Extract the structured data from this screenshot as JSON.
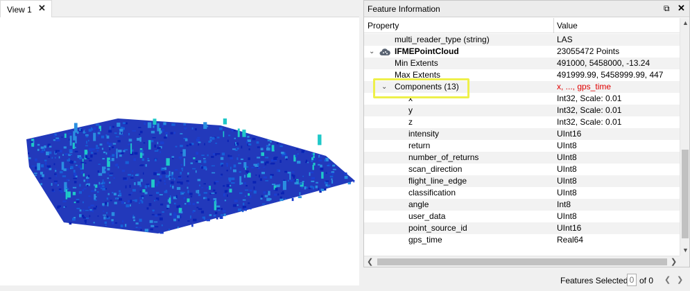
{
  "view": {
    "tab_label": "View 1",
    "close_glyph": "✕"
  },
  "panel": {
    "title": "Feature Information",
    "float_glyph": "⧉",
    "close_glyph": "✕",
    "col_property": "Property",
    "col_value": "Value"
  },
  "rows": [
    {
      "prop": "multi_reader_type (string)",
      "val": "LAS"
    },
    {
      "prop": "IFMEPointCloud",
      "val": "23055472 Points",
      "icon": "point-cloud-icon"
    },
    {
      "prop": "Min Extents",
      "val": "491000, 5458000, -13.24"
    },
    {
      "prop": "Max Extents",
      "val": "491999.99, 5458999.99, 447"
    },
    {
      "prop": "Components (13)",
      "val": "x, ..., gps_time"
    },
    {
      "prop": "x",
      "val": "Int32, Scale: 0.01"
    },
    {
      "prop": "y",
      "val": "Int32, Scale: 0.01"
    },
    {
      "prop": "z",
      "val": "Int32, Scale: 0.01"
    },
    {
      "prop": "intensity",
      "val": "UInt16"
    },
    {
      "prop": "return",
      "val": "UInt8"
    },
    {
      "prop": "number_of_returns",
      "val": "UInt8"
    },
    {
      "prop": "scan_direction",
      "val": "UInt8"
    },
    {
      "prop": "flight_line_edge",
      "val": "UInt8"
    },
    {
      "prop": "classification",
      "val": "UInt8"
    },
    {
      "prop": "angle",
      "val": "Int8"
    },
    {
      "prop": "user_data",
      "val": "UInt8"
    },
    {
      "prop": "point_source_id",
      "val": "UInt16"
    },
    {
      "prop": "gps_time",
      "val": "Real64"
    }
  ],
  "colors": {
    "highlight": "#eef04a",
    "components_value": "#e00000",
    "cloud_dark": "#0a23b4",
    "cloud_mid": "#1660d8",
    "cloud_cyan": "#1fc8c8"
  },
  "scroll": {
    "up": "▲",
    "down": "▼",
    "left": "❮",
    "right": "❯"
  },
  "status": {
    "selected_label": "Features Selected:",
    "selected_count": "0",
    "of_text": "of 0",
    "prev": "❮",
    "next": "❯"
  }
}
